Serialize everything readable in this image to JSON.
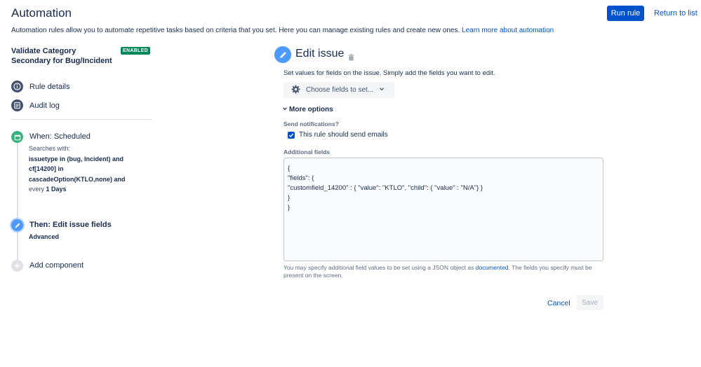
{
  "header": {
    "title": "Automation",
    "run_rule": "Run rule",
    "return_to_list": "Return to list",
    "description": "Automation rules allow you to automate repetitive tasks based on criteria that you set. Here you can manage existing rules and create new ones.",
    "learn_more": "Learn more about automation"
  },
  "rule": {
    "name": "Validate Category Secondary for Bug/Incident",
    "status": "ENABLED"
  },
  "nav": {
    "rule_details": "Rule details",
    "audit_log": "Audit log"
  },
  "trigger": {
    "title": "When: Scheduled",
    "searches_with": "Searches with:",
    "jql_line1": "issuetype in (bug, Incident) and",
    "jql_line2": "cf[14200] in",
    "jql_line3": "cascadeOption(KTLO,none) and",
    "every": "every",
    "interval": "1 Days"
  },
  "action": {
    "title": "Then: Edit issue fields",
    "subtitle": "Advanced"
  },
  "add_component": "Add component",
  "panel": {
    "title": "Edit issue",
    "set_values": "Set values for fields on the issue. Simply add the fields you want to edit.",
    "choose_fields": "Choose fields to set...",
    "more_options": "More options",
    "send_notifications": "Send notifications?",
    "send_emails": "This rule should send emails",
    "additional_fields_label": "Additional fields",
    "json_lines": [
      "{",
      "\"fields\": {",
      "\"customfield_14200\" : { \"value\": \"KTLO\", \"child\": { \"value\" : \"N/A\"} }",
      "}",
      "}"
    ],
    "help_pre": "You may specify additional field values to be set using a JSON object as",
    "help_link": "documented",
    "help_post": ". The fields you specify must be present on the screen.",
    "cancel": "Cancel",
    "save": "Save"
  },
  "colors": {
    "primary": "#0052cc",
    "enabled": "#00875a",
    "trigger_green": "#36b37e",
    "action_blue": "#4c9aff",
    "nav_icon": "#42526e"
  }
}
